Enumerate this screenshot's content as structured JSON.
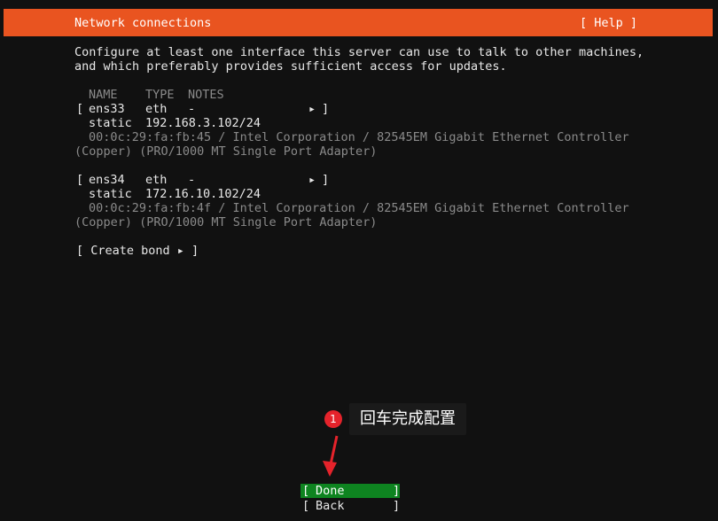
{
  "header": {
    "title": "Network connections",
    "help_label": "[ Help ]"
  },
  "intro": [
    "Configure at least one interface this server can use to talk to other machines,",
    "and which preferably provides sufficient access for updates."
  ],
  "table_header": {
    "name": "NAME",
    "type": "TYPE",
    "notes": "NOTES"
  },
  "interfaces": [
    {
      "name": "ens33",
      "type": "eth",
      "notes": "-",
      "mode": "static",
      "address": "192.168.3.102/24",
      "desc1": "00:0c:29:fa:fb:45 / Intel Corporation / 82545EM Gigabit Ethernet Controller",
      "desc2": "(Copper) (PRO/1000 MT Single Port Adapter)"
    },
    {
      "name": "ens34",
      "type": "eth",
      "notes": "-",
      "mode": "static",
      "address": "172.16.10.102/24",
      "desc1": "00:0c:29:fa:fb:4f / Intel Corporation / 82545EM Gigabit Ethernet Controller",
      "desc2": "(Copper) (PRO/1000 MT Single Port Adapter)"
    }
  ],
  "bracket_open": "[",
  "bracket_close": "]",
  "arrow_glyph": "▸",
  "create_bond_label": "[ Create bond ▸ ]",
  "buttons": {
    "done": "Done",
    "back": "Back"
  },
  "annotation": {
    "badge": "1",
    "text": "回车完成配置",
    "color": "#e5232b"
  }
}
